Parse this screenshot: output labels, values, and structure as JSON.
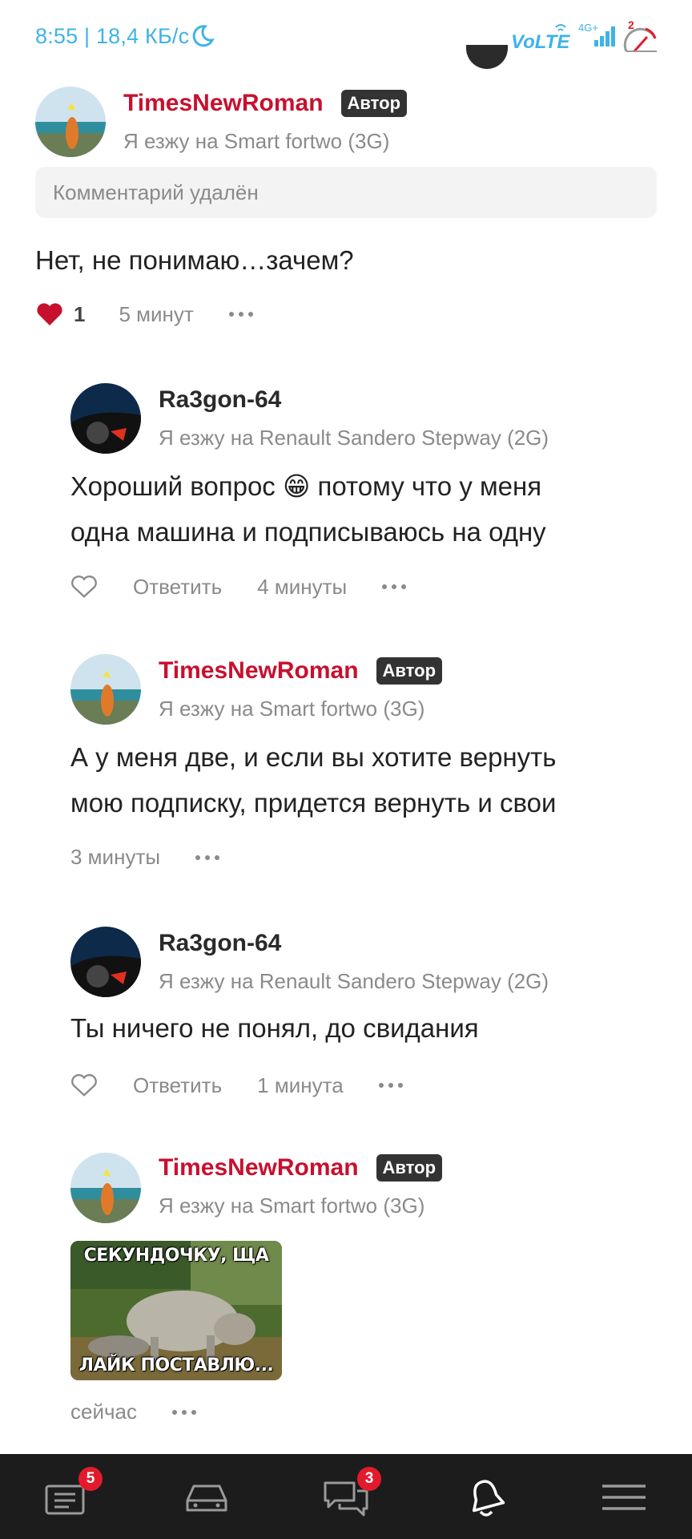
{
  "status_bar": {
    "time_speed": "8:55 | 18,4 КБ/с",
    "volte": "VoLTE",
    "network": "4G+",
    "sim_number": "2"
  },
  "thread": {
    "top_comment": {
      "author": "TimesNewRoman",
      "badge": "Автор",
      "car": "Я езжу на Smart fortwo (3G)",
      "quoted": "Комментарий удалён",
      "text": "Нет, не понимаю…зачем?",
      "likes": "1",
      "time": "5 минут"
    },
    "replies": [
      {
        "author": "Ra3gon-64",
        "car": "Я езжу на Renault Sandero Stepway (2G)",
        "text_line1": "Хороший вопрос 😁 потому что у меня",
        "text_line2": "одна машина и подписываюсь на одну",
        "reply_label": "Ответить",
        "time": "4 минуты"
      },
      {
        "author": "TimesNewRoman",
        "badge": "Автор",
        "car": "Я езжу на Smart fortwo (3G)",
        "text_line1": "А у меня две, и если вы хотите вернуть",
        "text_line2": "мою подписку, придется вернуть и свои",
        "time": "3 минуты"
      },
      {
        "author": "Ra3gon-64",
        "car": "Я езжу на Renault Sandero Stepway (2G)",
        "text_line1": "Ты ничего не понял, до свидания",
        "reply_label": "Ответить",
        "time": "1 минута"
      },
      {
        "author": "TimesNewRoman",
        "badge": "Автор",
        "car": "Я езжу на Smart fortwo (3G)",
        "meme_top": "СЕКУНДОЧКУ, ЩА",
        "meme_bottom": "ЛАЙК ПОСТАВЛЮ...",
        "time": "сейчас"
      }
    ]
  },
  "nav": {
    "items": [
      {
        "icon": "feed-icon",
        "badge": "5"
      },
      {
        "icon": "car-icon"
      },
      {
        "icon": "chat-icon",
        "badge": "3"
      },
      {
        "icon": "bell-icon"
      },
      {
        "icon": "menu-icon"
      }
    ]
  },
  "colors": {
    "accent_red": "#c8102e",
    "status_blue": "#3fb3e6",
    "nav_bg": "#1c1c1c",
    "badge_red": "#e21b2c"
  }
}
